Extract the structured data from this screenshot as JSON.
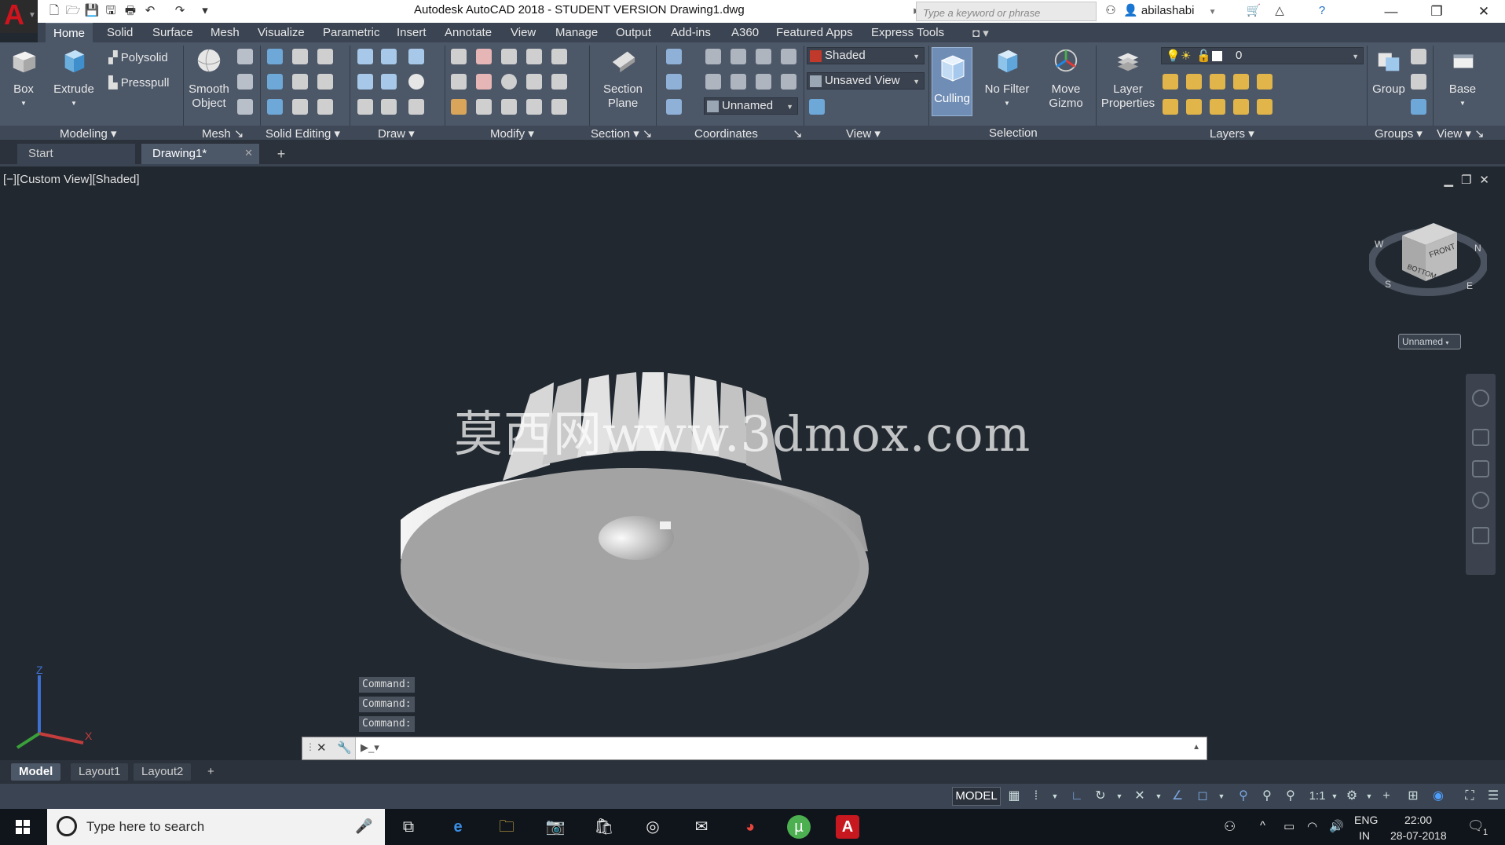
{
  "titlebar": {
    "title": "Autodesk AutoCAD 2018 - STUDENT VERSION    Drawing1.dwg",
    "search_placeholder": "Type a keyword or phrase",
    "username": "abilashabi"
  },
  "menu_tabs": [
    "Home",
    "Solid",
    "Surface",
    "Mesh",
    "Visualize",
    "Parametric",
    "Insert",
    "Annotate",
    "View",
    "Manage",
    "Output",
    "Add-ins",
    "A360",
    "Featured Apps",
    "Express Tools"
  ],
  "ribbon": {
    "box": "Box",
    "extrude": "Extrude",
    "polysolid": "Polysolid",
    "presspull": "Presspull",
    "smooth_object": "Smooth Object",
    "section_plane": "Section Plane",
    "visual_style": "Shaded",
    "view_name": "Unsaved View",
    "ucs_name": "Unnamed",
    "culling": "Culling",
    "no_filter": "No Filter",
    "move_gizmo": "Move Gizmo",
    "layer_properties": "Layer Properties",
    "layer_name": "0",
    "group": "Group",
    "base": "Base",
    "groups": {
      "modeling": "Modeling",
      "mesh": "Mesh",
      "solid_editing": "Solid Editing",
      "draw": "Draw",
      "modify": "Modify",
      "section": "Section",
      "coordinates": "Coordinates",
      "view": "View",
      "selection": "Selection",
      "layers": "Layers",
      "groups_label": "Groups",
      "view2": "View"
    }
  },
  "doc_tabs": {
    "start": "Start",
    "drawing": "Drawing1*"
  },
  "viewport": {
    "label": "[−][Custom View][Shaded]",
    "watermark": "莫西网www.3dmox.com",
    "viewcube_name": "Unnamed",
    "viewcube_faces": {
      "front": "FRONT",
      "bottom": "BOTTOM"
    },
    "compass": {
      "w": "W",
      "s": "S",
      "n": "N",
      "e": "E"
    },
    "ucs": {
      "x": "X",
      "z": "Z"
    }
  },
  "command_history": [
    "Command:",
    "Command:",
    "Command:"
  ],
  "command_line": {
    "value": ""
  },
  "layout_tabs": [
    "Model",
    "Layout1",
    "Layout2"
  ],
  "statusbar": {
    "model": "MODEL",
    "scale": "1:1"
  },
  "taskbar": {
    "search_placeholder": "Type here to search",
    "language": "ENG",
    "region": "IN",
    "time": "22:00",
    "date": "28-07-2018",
    "notifications": "1"
  },
  "colors": {
    "viewport_bg": "#212830",
    "ribbon_bg": "#4c5768",
    "culling_active": "#6f8db5",
    "autocad_red": "#d0141e"
  }
}
